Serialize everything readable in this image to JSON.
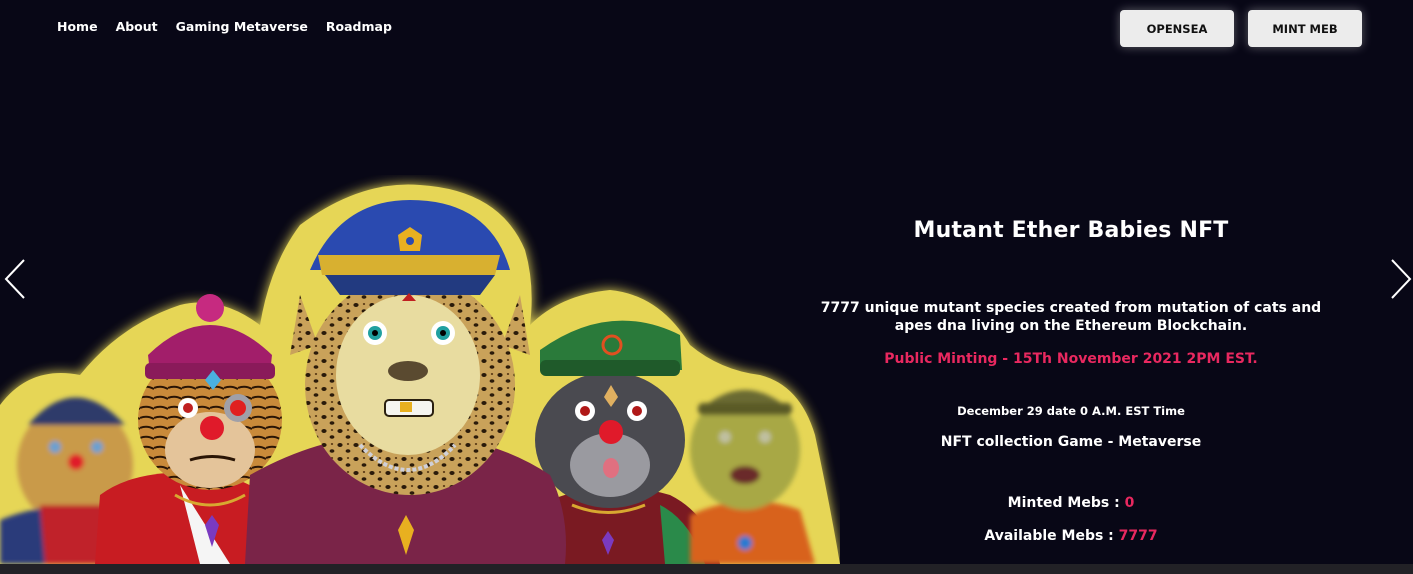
{
  "nav": {
    "items": [
      {
        "label": "Home"
      },
      {
        "label": "About"
      },
      {
        "label": "Gaming Metaverse"
      },
      {
        "label": "Roadmap"
      }
    ]
  },
  "buttons": {
    "opensea_label": "OPENSEA",
    "mint_label": "MINT MEB"
  },
  "hero": {
    "title": "Mutant Ether Babies NFT",
    "description_line1": "7777 unique mutant species created from mutation of cats and",
    "description_line2": "apes dna living on the Ethereum Blockchain.",
    "minting": "Public Minting - 15Th November 2021 2PM EST.",
    "date": "December 29 date 0 A.M. EST Time",
    "game": "NFT collection Game - Metaverse",
    "minted_label": "Minted Mebs : ",
    "minted_value": "0",
    "available_label": "Available Mebs : ",
    "available_value": "7777"
  },
  "icons": {
    "prev": "chevron-left-icon",
    "next": "chevron-right-icon"
  },
  "colors": {
    "background": "#080716",
    "accent": "#e8285f",
    "button_bg": "#ececec"
  }
}
